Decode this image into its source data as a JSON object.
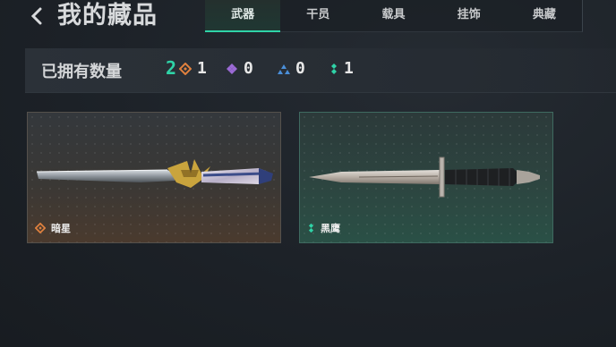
{
  "header": {
    "title": "我的藏品",
    "tabs": [
      {
        "label": "武器",
        "active": true
      },
      {
        "label": "干员",
        "active": false
      },
      {
        "label": "载具",
        "active": false
      },
      {
        "label": "挂饰",
        "active": false
      },
      {
        "label": "典藏",
        "active": false
      }
    ]
  },
  "summary": {
    "label": "已拥有数量",
    "total": "2",
    "rarities": [
      {
        "icon": "orange-diamond-icon",
        "color": "#e0813e",
        "count": "1"
      },
      {
        "icon": "purple-diamond-icon",
        "color": "#9b6ad6",
        "count": "0"
      },
      {
        "icon": "blue-triangle-icon",
        "color": "#4a8fd9",
        "count": "0"
      },
      {
        "icon": "green-dots-icon",
        "color": "#2fd3a7",
        "count": "1"
      }
    ]
  },
  "items": [
    {
      "name": "暗星",
      "rarity_icon": "orange-diamond-icon",
      "rarity_color": "#e0813e"
    },
    {
      "name": "黑鹰",
      "rarity_icon": "green-dots-icon",
      "rarity_color": "#2fd3a7"
    }
  ],
  "colors": {
    "accent": "#2fd3a7",
    "background": "#1c2127"
  }
}
